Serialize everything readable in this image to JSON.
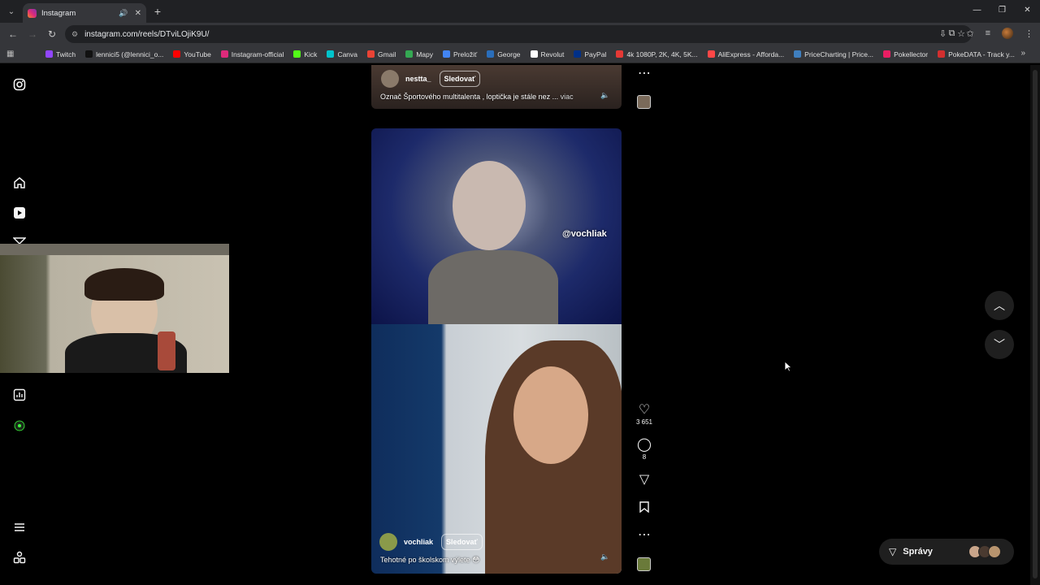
{
  "browser": {
    "tab_title": "Instagram",
    "url": "instagram.com/reels/DTviLOjiK9U/",
    "bookmarks": [
      {
        "label": "Twitch",
        "color": "#9146ff"
      },
      {
        "label": "lennici5 (@lennici_o...",
        "color": "#111111"
      },
      {
        "label": "YouTube",
        "color": "#ff0000"
      },
      {
        "label": "Instagram-official",
        "color": "#dd2a7b"
      },
      {
        "label": "Kick",
        "color": "#53fc18"
      },
      {
        "label": "Canva",
        "color": "#00c4cc"
      },
      {
        "label": "Gmail",
        "color": "#ea4335"
      },
      {
        "label": "Mapy",
        "color": "#34a853"
      },
      {
        "label": "Preložiť",
        "color": "#4285f4"
      },
      {
        "label": "George",
        "color": "#2a6ebb"
      },
      {
        "label": "Revolut",
        "color": "#ffffff"
      },
      {
        "label": "PayPal",
        "color": "#003087"
      },
      {
        "label": "4k 1080P, 2K, 4K, 5K...",
        "color": "#e53935"
      },
      {
        "label": "AliExpress - Afforda...",
        "color": "#ff4747"
      },
      {
        "label": "PriceCharting | Price...",
        "color": "#3f7fbf"
      },
      {
        "label": "Pokellector",
        "color": "#e91e63"
      },
      {
        "label": "PokeDATA - Track y...",
        "color": "#d32f2f"
      }
    ]
  },
  "reel_top": {
    "username": "nestta_",
    "follow_label": "Sledovať",
    "caption": "Označ Športového multitalenta , loptička je stále nez ...",
    "more_label": "viac"
  },
  "reel_main": {
    "overlay_handle": "@vochliak",
    "username": "vochliak",
    "follow_label": "Sledovať",
    "caption": "Tehotné po školskom výlete 😳",
    "likes": "3 651",
    "comments": "8"
  },
  "messages": {
    "label": "Správy"
  },
  "colors": {
    "background": "#000000",
    "panel": "#1f1f1f",
    "text": "#f5f5f5"
  },
  "icons": [
    "instagram-icon",
    "home-icon",
    "reels-icon",
    "messages-icon",
    "insights-icon",
    "profile-icon",
    "menu-icon",
    "apps-icon",
    "heart-icon",
    "comment-icon",
    "share-icon",
    "bookmark-icon",
    "more-icon",
    "chevron-up-icon",
    "chevron-down-icon",
    "sound-icon"
  ]
}
